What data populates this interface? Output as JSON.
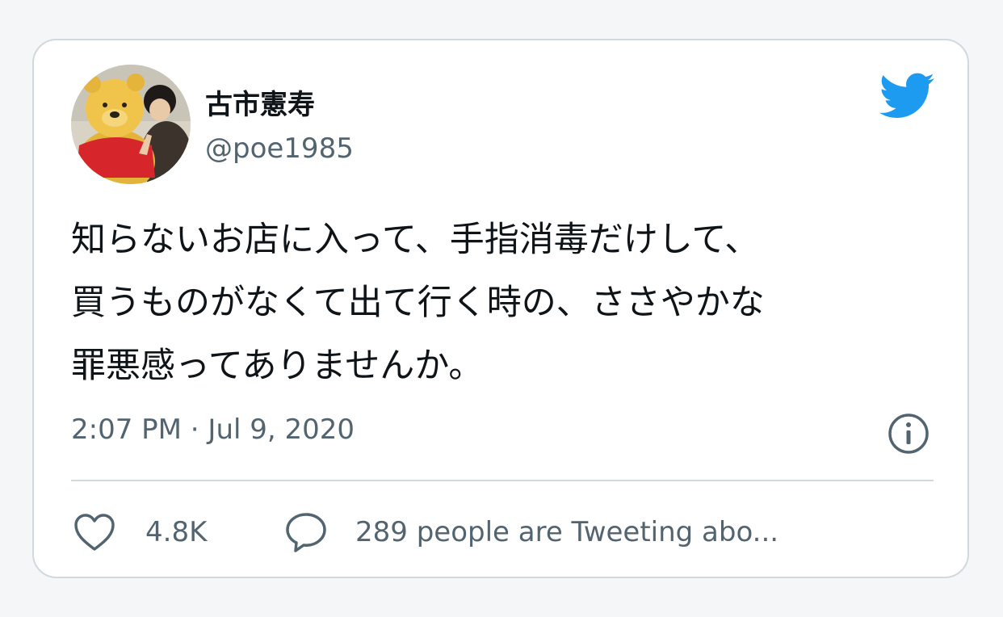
{
  "tweet": {
    "author": {
      "display_name": "古市憲寿",
      "handle": "@poe1985"
    },
    "text_lines": [
      "知らないお店に入って、手指消毒だけして、",
      "買うものがなくて出て行く時の、ささやかな",
      "罪悪感ってありませんか。"
    ],
    "timestamp": "2:07 PM · Jul 9, 2020",
    "likes": "4.8K",
    "reply_text": "289 people are Tweeting abo..."
  },
  "icons": {
    "brand": "twitter-bird-icon",
    "info": "info-icon",
    "like": "heart-icon",
    "reply": "speech-bubble-icon"
  },
  "colors": {
    "twitter_blue": "#1d9bf0",
    "text_primary": "#0f1419",
    "text_secondary": "#536471",
    "border": "#cfd9de"
  }
}
